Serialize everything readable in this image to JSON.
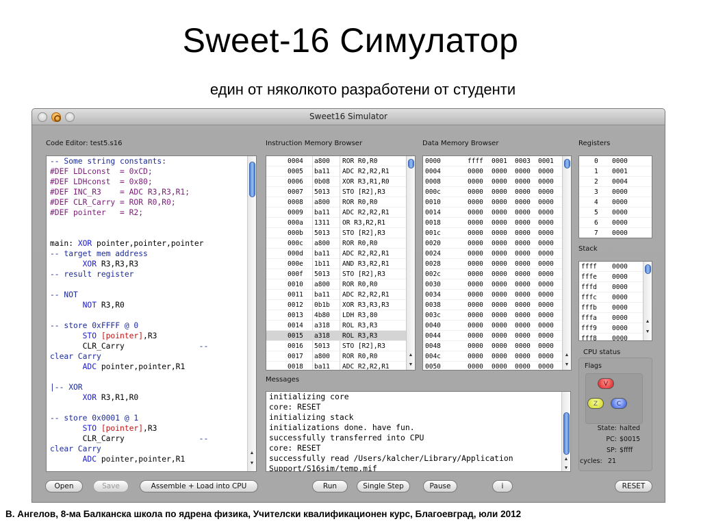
{
  "slide": {
    "title": "Sweet-16 Симулатор",
    "subtitle": "един от няколкото разработени от студенти",
    "footer": "В. Ангелов, 8-ма Балканска школа по ядрена физика, Учителски квалификационен курс, Благоевград, юли 2012"
  },
  "window": {
    "title": "Sweet16 Simulator"
  },
  "code_editor": {
    "label": "Code Editor:  test5.s16",
    "lines": [
      {
        "t": "-- Some string constants:",
        "k": "comment"
      },
      {
        "t": "#DEF LDLconst  = 0xCD;",
        "k": "def"
      },
      {
        "t": "#DEF LDHconst  = 0x80;",
        "k": "def"
      },
      {
        "t": "#DEF INC_R3    = ADC R3,R3,R1;",
        "k": "def"
      },
      {
        "t": "#DEF CLR_Carry = ROR R0,R0;",
        "k": "def"
      },
      {
        "t": "#DEF pointer   = R2;",
        "k": "def"
      },
      {
        "t": "",
        "k": "plain"
      },
      {
        "t": "",
        "k": "plain"
      },
      {
        "t": "main: XOR pointer,pointer,pointer",
        "k": "main"
      },
      {
        "t": "-- target mem address",
        "k": "comment"
      },
      {
        "t": "       XOR R3,R3,R3",
        "k": "instr"
      },
      {
        "t": "-- result register",
        "k": "comment"
      },
      {
        "t": "",
        "k": "plain"
      },
      {
        "t": "-- NOT",
        "k": "comment"
      },
      {
        "t": "       NOT R3,R0",
        "k": "instr"
      },
      {
        "t": "",
        "k": "plain"
      },
      {
        "t": "-- store 0xFFFF @ 0",
        "k": "comment"
      },
      {
        "t": "       STO [pointer],R3",
        "k": "sto"
      },
      {
        "t": "       CLR_Carry                --",
        "k": "clr"
      },
      {
        "t": "clear Carry",
        "k": "commentleft"
      },
      {
        "t": "       ADC pointer,pointer,R1",
        "k": "instr"
      },
      {
        "t": "",
        "k": "plain"
      },
      {
        "t": "|-- XOR",
        "k": "comment"
      },
      {
        "t": "       XOR R3,R1,R0",
        "k": "instr"
      },
      {
        "t": "",
        "k": "plain"
      },
      {
        "t": "-- store 0x0001 @ 1",
        "k": "comment"
      },
      {
        "t": "       STO [pointer],R3",
        "k": "sto"
      },
      {
        "t": "       CLR_Carry                --",
        "k": "clr"
      },
      {
        "t": "clear Carry",
        "k": "commentleft"
      },
      {
        "t": "       ADC pointer,pointer,R1",
        "k": "instr"
      }
    ]
  },
  "instruction_memory": {
    "label": "Instruction Memory Browser",
    "highlighted_addr": "0015",
    "rows": [
      [
        "0004",
        "a800",
        "ROR R0,R0"
      ],
      [
        "0005",
        "ba11",
        "ADC R2,R2,R1"
      ],
      [
        "0006",
        "0b08",
        "XOR R3,R1,R0"
      ],
      [
        "0007",
        "5013",
        "STO [R2],R3"
      ],
      [
        "0008",
        "a800",
        "ROR R0,R0"
      ],
      [
        "0009",
        "ba11",
        "ADC R2,R2,R1"
      ],
      [
        "000a",
        "1311",
        "OR R3,R2,R1"
      ],
      [
        "000b",
        "5013",
        "STO [R2],R3"
      ],
      [
        "000c",
        "a800",
        "ROR R0,R0"
      ],
      [
        "000d",
        "ba11",
        "ADC R2,R2,R1"
      ],
      [
        "000e",
        "1b11",
        "AND R3,R2,R1"
      ],
      [
        "000f",
        "5013",
        "STO [R2],R3"
      ],
      [
        "0010",
        "a800",
        "ROR R0,R0"
      ],
      [
        "0011",
        "ba11",
        "ADC R2,R2,R1"
      ],
      [
        "0012",
        "0b1b",
        "XOR R3,R3,R3"
      ],
      [
        "0013",
        "4b80",
        "LDH R3,80"
      ],
      [
        "0014",
        "a318",
        "ROL R3,R3"
      ],
      [
        "0015",
        "a318",
        "ROL R3,R3"
      ],
      [
        "0016",
        "5013",
        "STO [R2],R3"
      ],
      [
        "0017",
        "a800",
        "ROR R0,R0"
      ],
      [
        "0018",
        "ba11",
        "ADC R2,R2,R1"
      ]
    ]
  },
  "data_memory": {
    "label": "Data Memory Browser",
    "rows": [
      [
        "0000",
        "ffff",
        "0001",
        "0003",
        "0001"
      ],
      [
        "0004",
        "0000",
        "0000",
        "0000",
        "0000"
      ],
      [
        "0008",
        "0000",
        "0000",
        "0000",
        "0000"
      ],
      [
        "000c",
        "0000",
        "0000",
        "0000",
        "0000"
      ],
      [
        "0010",
        "0000",
        "0000",
        "0000",
        "0000"
      ],
      [
        "0014",
        "0000",
        "0000",
        "0000",
        "0000"
      ],
      [
        "0018",
        "0000",
        "0000",
        "0000",
        "0000"
      ],
      [
        "001c",
        "0000",
        "0000",
        "0000",
        "0000"
      ],
      [
        "0020",
        "0000",
        "0000",
        "0000",
        "0000"
      ],
      [
        "0024",
        "0000",
        "0000",
        "0000",
        "0000"
      ],
      [
        "0028",
        "0000",
        "0000",
        "0000",
        "0000"
      ],
      [
        "002c",
        "0000",
        "0000",
        "0000",
        "0000"
      ],
      [
        "0030",
        "0000",
        "0000",
        "0000",
        "0000"
      ],
      [
        "0034",
        "0000",
        "0000",
        "0000",
        "0000"
      ],
      [
        "0038",
        "0000",
        "0000",
        "0000",
        "0000"
      ],
      [
        "003c",
        "0000",
        "0000",
        "0000",
        "0000"
      ],
      [
        "0040",
        "0000",
        "0000",
        "0000",
        "0000"
      ],
      [
        "0044",
        "0000",
        "0000",
        "0000",
        "0000"
      ],
      [
        "0048",
        "0000",
        "0000",
        "0000",
        "0000"
      ],
      [
        "004c",
        "0000",
        "0000",
        "0000",
        "0000"
      ],
      [
        "0050",
        "0000",
        "0000",
        "0000",
        "0000"
      ]
    ]
  },
  "registers": {
    "label": "Registers",
    "rows": [
      [
        "0",
        "0000"
      ],
      [
        "1",
        "0001"
      ],
      [
        "2",
        "0004"
      ],
      [
        "3",
        "0000"
      ],
      [
        "4",
        "0000"
      ],
      [
        "5",
        "0000"
      ],
      [
        "6",
        "0000"
      ],
      [
        "7",
        "0000"
      ]
    ]
  },
  "stack": {
    "label": "Stack",
    "rows": [
      [
        "ffff",
        "0000"
      ],
      [
        "fffe",
        "0000"
      ],
      [
        "fffd",
        "0000"
      ],
      [
        "fffc",
        "0000"
      ],
      [
        "fffb",
        "0000"
      ],
      [
        "fffa",
        "0000"
      ],
      [
        "fff9",
        "0000"
      ],
      [
        "fff8",
        "0000"
      ]
    ]
  },
  "cpu_status": {
    "label": "CPU status",
    "flags_label": "Flags",
    "flags": {
      "v": "V",
      "z": "Z",
      "c": "C"
    },
    "state_label": "State:",
    "state": "halted",
    "pc_label": "PC:",
    "pc": "$0015",
    "sp_label": "SP:",
    "sp": "$ffff",
    "cycles_label": "cycles:",
    "cycles": "21"
  },
  "messages": {
    "label": "Messages",
    "lines": [
      "initializing core",
      "core: RESET",
      "initializing stack",
      "initializations done. have fun.",
      "successfully transferred into CPU",
      "core: RESET",
      "successfully read /Users/kalcher/Library/Application",
      "Support/S16sim/temp.mif"
    ]
  },
  "buttons": {
    "open": "Open",
    "save": "Save",
    "assemble": "Assemble + Load into CPU",
    "run": "Run",
    "single_step": "Single Step",
    "pause": "Pause",
    "info": "i",
    "reset": "RESET"
  }
}
